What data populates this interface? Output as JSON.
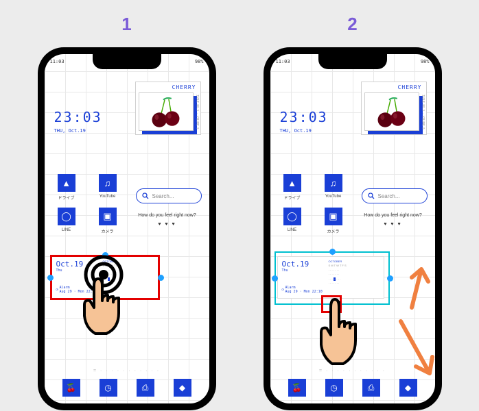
{
  "steps": {
    "one": "1",
    "two": "2"
  },
  "status": {
    "time": "11:03",
    "battery": "98%"
  },
  "cherry": {
    "label": "CHERRY",
    "side": "ISSUE NO.3 - VOLUME 9"
  },
  "clock": {
    "time": "23:03",
    "date": "THU, Oct.19"
  },
  "apps": {
    "row1": [
      {
        "label": "ドライブ",
        "icon": "▲"
      },
      {
        "label": "YouTube",
        "icon": "♫"
      }
    ],
    "row2": [
      {
        "label": "LINE",
        "icon": "◯"
      },
      {
        "label": "カメラ",
        "icon": "▣"
      }
    ]
  },
  "search": {
    "placeholder": "Search..."
  },
  "feel": {
    "text": "How do you feel right now?",
    "hearts": "♥ ♥ ♥"
  },
  "calendar": {
    "date": "Oct.19",
    "day": "Thu",
    "month": "OCTOBER",
    "alarm": "Alarm",
    "alarm_sub": "Aug 29 · Mon 22:10"
  },
  "pager": "= · · · · · · · · · · ·",
  "dock": [
    "🍒",
    "◷",
    "⎙",
    "◆"
  ]
}
